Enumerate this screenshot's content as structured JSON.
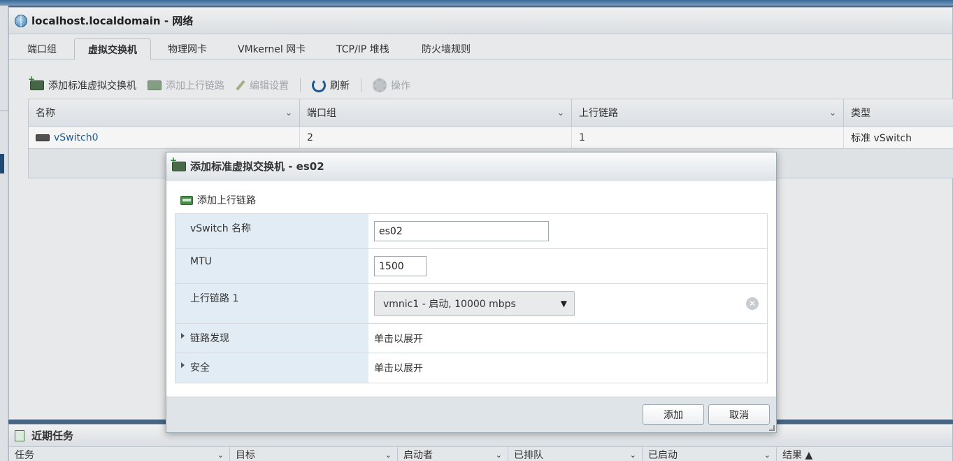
{
  "window": {
    "title": "localhost.localdomain - 网络"
  },
  "tabs": [
    "端口组",
    "虚拟交换机",
    "物理网卡",
    "VMkernel 网卡",
    "TCP/IP 堆栈",
    "防火墙规则"
  ],
  "active_tab": "虚拟交换机",
  "toolbar": {
    "add_vswitch": "添加标准虚拟交换机",
    "add_uplink": "添加上行链路",
    "edit_settings": "编辑设置",
    "refresh": "刷新",
    "actions": "操作"
  },
  "grid": {
    "columns": [
      "名称",
      "端口组",
      "上行链路",
      "类型"
    ],
    "rows": [
      {
        "name": "vSwitch0",
        "portgroups": "2",
        "uplinks": "1",
        "type": "标准 vSwitch"
      }
    ]
  },
  "dialog": {
    "title": "添加标准虚拟交换机 - es02",
    "add_uplink": "添加上行链路",
    "fields": {
      "name_label": "vSwitch 名称",
      "name_value": "es02",
      "mtu_label": "MTU",
      "mtu_value": "1500",
      "uplink_label": "上行链路 1",
      "uplink_value": "vmnic1 - 启动, 10000 mbps",
      "discovery_label": "链路发现",
      "discovery_value": "单击以展开",
      "security_label": "安全",
      "security_value": "单击以展开"
    },
    "buttons": {
      "add": "添加",
      "cancel": "取消"
    }
  },
  "tasks": {
    "title": "近期任务",
    "columns": [
      "任务",
      "目标",
      "启动者",
      "已排队",
      "已启动",
      "结果 ▲"
    ]
  }
}
